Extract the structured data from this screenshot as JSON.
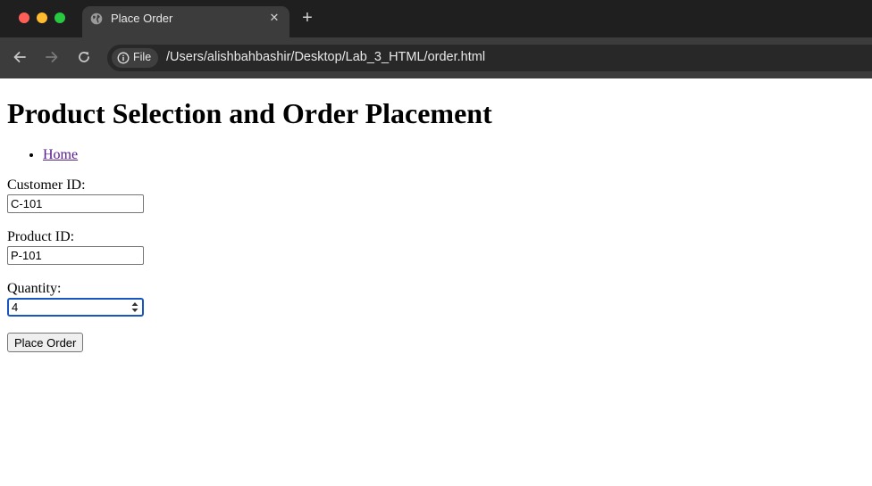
{
  "browser": {
    "tab_title": "Place Order",
    "close_glyph": "✕",
    "new_tab_glyph": "+",
    "file_chip_label": "File",
    "url": "/Users/alishbahbashir/Desktop/Lab_3_HTML/order.html"
  },
  "page": {
    "heading": "Product Selection and Order Placement",
    "nav": [
      {
        "label": "Home"
      }
    ],
    "form": {
      "customer_id": {
        "label": "Customer ID:",
        "value": "C-101"
      },
      "product_id": {
        "label": "Product ID:",
        "value": "P-101"
      },
      "quantity": {
        "label": "Quantity:",
        "value": "4"
      },
      "submit_label": "Place Order"
    }
  },
  "icons": {
    "favicon": "globe-icon",
    "back": "arrow-left-icon",
    "forward": "arrow-right-icon",
    "reload": "reload-icon",
    "file_info": "info-icon",
    "quantity_spinner": "spinner-arrows-icon"
  },
  "colors": {
    "chrome_bg": "#1f1f1f",
    "toolbar_bg": "#3c3c3c",
    "omnibox_bg": "#282828",
    "link_visited": "#551a8b",
    "focus_ring": "#1a56c0",
    "close_red": "#ff5f57",
    "minimize_yellow": "#febc2e",
    "zoom_green": "#28c840"
  }
}
